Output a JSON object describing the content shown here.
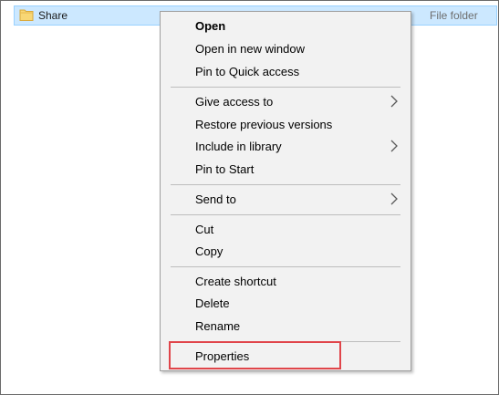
{
  "file": {
    "name": "Share",
    "type": "File folder",
    "icon": "folder-icon"
  },
  "menu": {
    "open": "Open",
    "open_new_window": "Open in new window",
    "pin_quick_access": "Pin to Quick access",
    "give_access": "Give access to",
    "restore_versions": "Restore previous versions",
    "include_library": "Include in library",
    "pin_start": "Pin to Start",
    "send_to": "Send to",
    "cut": "Cut",
    "copy": "Copy",
    "create_shortcut": "Create shortcut",
    "delete": "Delete",
    "rename": "Rename",
    "properties": "Properties"
  },
  "colors": {
    "selection_bg": "#cce8ff",
    "menu_bg": "#f2f2f2",
    "highlight": "#e0454a"
  }
}
